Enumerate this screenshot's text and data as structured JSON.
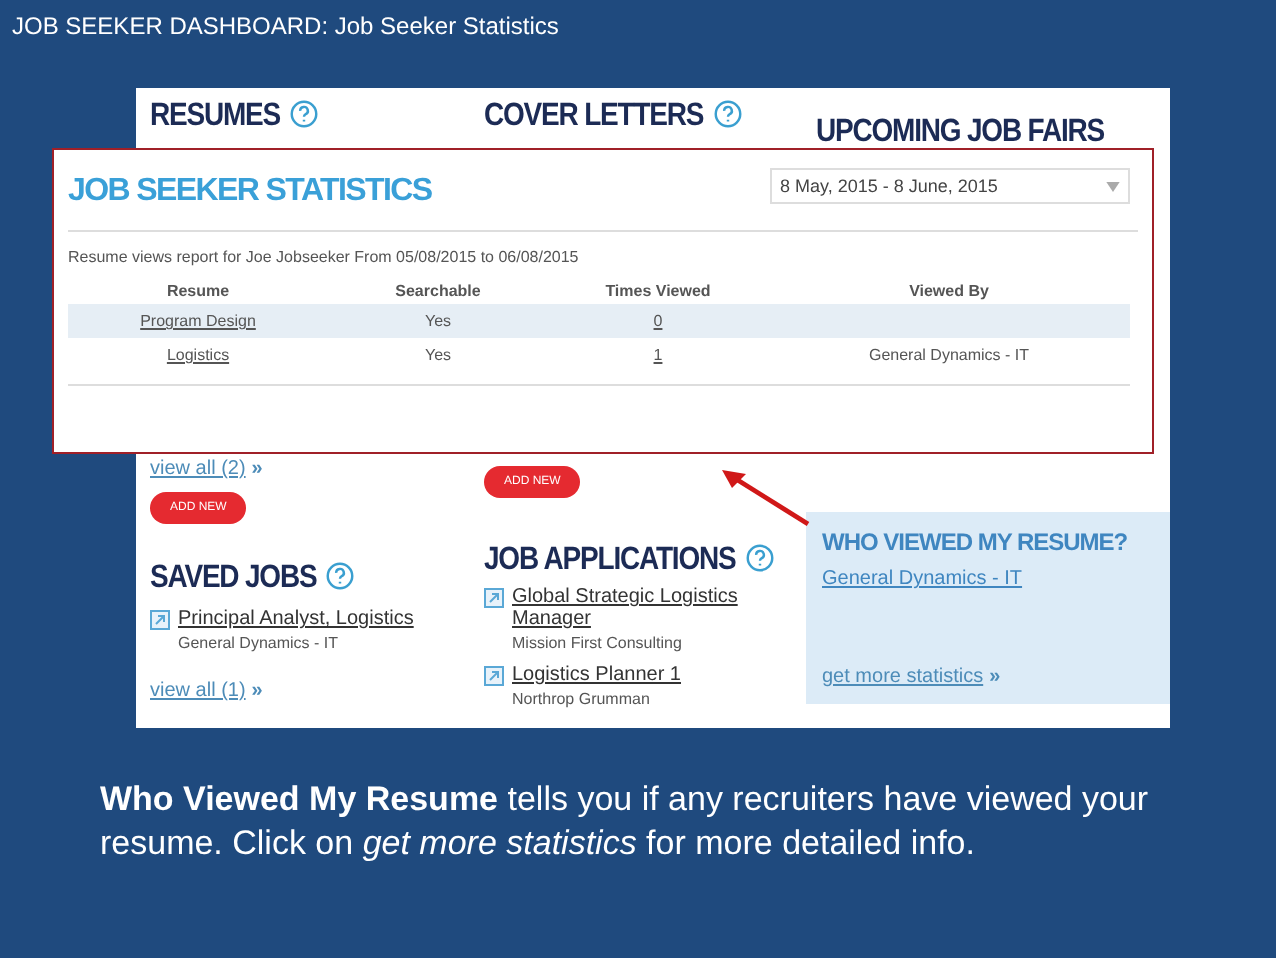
{
  "slide_title": "JOB SEEKER DASHBOARD: Job Seeker Statistics",
  "dashboard": {
    "resumes": {
      "title": "RESUMES",
      "view_all": "view all (2)",
      "view_all_arrow": "»",
      "button": "ADD NEW"
    },
    "cover_letters": {
      "title": "COVER LETTERS",
      "button": "ADD NEW"
    },
    "job_fairs": {
      "title": "UPCOMING JOB FAIRS"
    },
    "saved_jobs": {
      "title": "SAVED JOBS",
      "items": [
        {
          "title": "Principal Analyst, Logistics",
          "company": "General Dynamics - IT"
        }
      ],
      "view_all": "view all (1)",
      "view_all_arrow": "»"
    },
    "job_applications": {
      "title": "JOB APPLICATIONS",
      "items": [
        {
          "title": "Global Strategic Logistics Manager",
          "company": "Mission First Consulting"
        },
        {
          "title": "Logistics Planner 1",
          "company": "Northrop Grumman"
        }
      ]
    },
    "who_viewed": {
      "title": "WHO VIEWED MY RESUME?",
      "viewer": "General Dynamics - IT",
      "more": "get more statistics",
      "more_arrow": "»"
    }
  },
  "statistics": {
    "title": "JOB SEEKER STATISTICS",
    "date_range": "8 May, 2015 - 8 June, 2015",
    "report": "Resume views report for Joe Jobseeker From 05/08/2015 to 06/08/2015",
    "columns": [
      "Resume",
      "Searchable",
      "Times Viewed",
      "Viewed By"
    ],
    "rows": [
      {
        "resume": "Program Design",
        "searchable": "Yes",
        "times_viewed": "0",
        "highlighted": true
      },
      {
        "resume": "Logistics",
        "searchable": "Yes",
        "times_viewed": "1",
        "viewed_by": "General Dynamics - IT",
        "highlighted": false
      }
    ]
  },
  "caption": "**Who Viewed My Resume** tells you if any recruiters have viewed your resume. Click on *get more statistics* for more detailed info."
}
